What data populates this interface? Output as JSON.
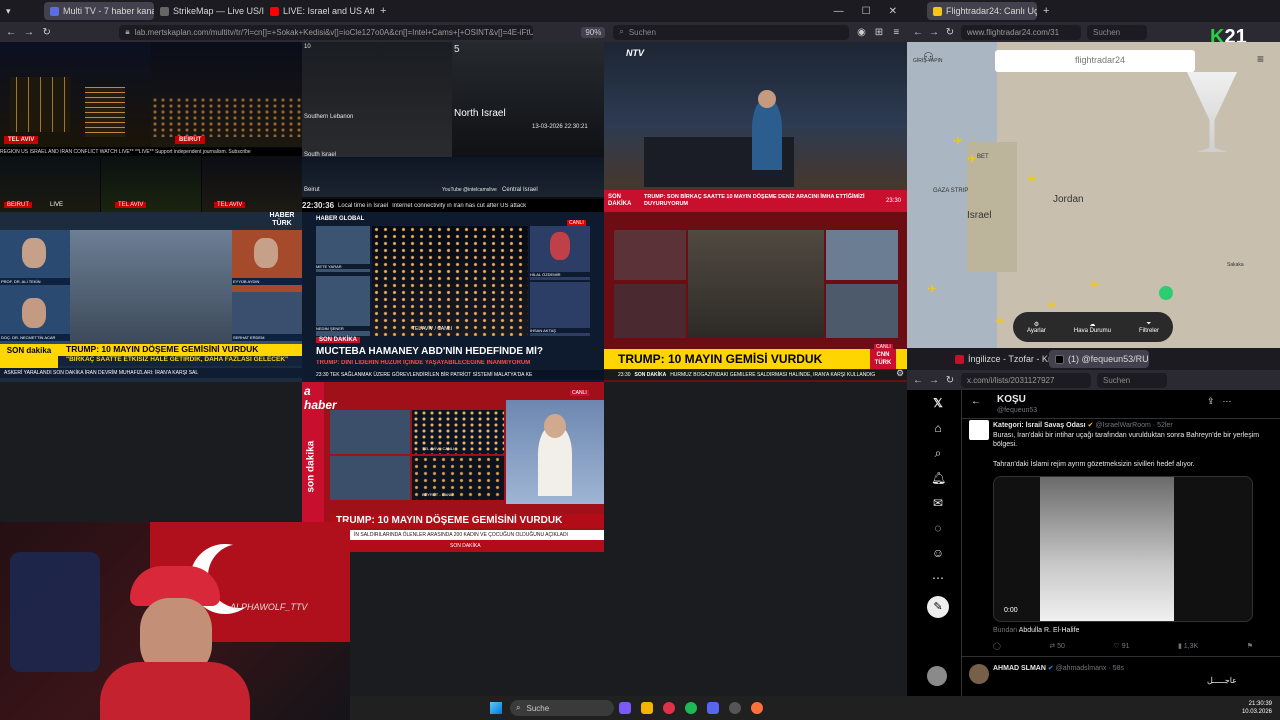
{
  "left_browser": {
    "tabs": [
      {
        "label": "Multi TV - 7 haber kanalını",
        "color": "#5b6ee1"
      },
      {
        "label": "StrikeMap — Live US/Israel Ira",
        "color": "#444"
      },
      {
        "label": "LIVE: Israel and US Attack I",
        "color": "#ff0000"
      }
    ],
    "url": "lab.mertskaplan.com/multitv/tr/?l=cn[]=+Sokak+Kedisi&v[]=ioCle127o0A&cn[]=Intel+Cams+[+OSINT&v[]=4E-iFtUM2kk",
    "zoom": "90%",
    "search_placeholder": "Suchen"
  },
  "tiles": {
    "t1": {
      "label1": "TEL AVIV",
      "label2": "BEIRUT",
      "label3": "TEL AVIV",
      "label4": "BEIRUT",
      "label5": "TEL AVIV",
      "ticker": "REGION US ISRAEL AND IRAN CONFLICT WATCH LIVE** **LIVE** Support independent journalism. Subscribe",
      "live": "LIVE"
    },
    "t2": {
      "title": "North Israel",
      "sub1": "Southern Lebanon",
      "sub2": "South Israel",
      "sub3": "Beirut",
      "sub4": "Central Israel",
      "time": "22:30:36",
      "ticker": "Local time in Israel",
      "ticker2": "Internet connectivity in Iran has cut after US attack",
      "handle": "YouTube @intelcamslive",
      "n5": "5",
      "n10": "10",
      "date1": "13-03-2026 22:30:21"
    },
    "t3": {
      "brand": "NTV",
      "headline_tag": "SON DAKİKA",
      "headline": "TRUMP: SON BİRKAÇ SAATTE 10 MAYIN DÖŞEME DENİZ ARACINI İMHA ETTİĞİMİZİ DUYURUYORUM",
      "time": "23:30"
    },
    "t4": {
      "brand": "HABER TÜRK",
      "badge": "SON dakika",
      "headline": "TRUMP: 10 MAYIN DÖŞEME GEMİSİNİ VURDUK",
      "sub": "\"BİRKAÇ SAATTE ETKİSİZ HALE GETİRDİK, DAHA FAZLASI GELECEK\"",
      "ticker": "ASKERİ YARALANDI   SON DAKİKA   İRAN DEVRİM MUHAFIZLARI: İRAN'A KARŞI SAL",
      "guest1": "PROF. DR. ALİ TEKİN",
      "guest2": "DOÇ. DR. NECMETTİN ACAR",
      "anchor": "EYYÜB AYDIN",
      "guest3": "SERHAT ERDEM"
    },
    "t5": {
      "brand": "HABER GLOBAL",
      "tag": "SON DAKİKA",
      "headline": "MÜCTEBA HAMANEY ABD'NİN HEDEFİNDE Mİ?",
      "sub": "TRUMP: DİNİ LİDERİN HUZUR İÇİNDE YAŞAYABİLECEĞİNE İNANMIYORUM",
      "ticker": "23:30  TEK SAĞLANMAK ÜZERE GÖREVLENDİRİLEN BİR PATRİOT SİSTEMİ MALATYA'DA KE",
      "loc": "TEL AVİV / CANLI",
      "g1": "METE YARAR",
      "g2": "NEDİM ŞENER",
      "g3": "İHSAN AKTAŞ",
      "g4": "HİLAL ÖZDEMİR",
      "live": "CANLI"
    },
    "t6": {
      "brand": "CNN TÜRK",
      "headline": "TRUMP: 10 MAYIN GEMİSİ VURDUK",
      "tag": "SON DAKİKA",
      "ticker": "HÜRMÜZ BOĞAZI'NDAKİ GEMİLERE SALDIRMASI HALİNDE, İRAN'A KARŞI KULLANDIĞ",
      "time": "23:30",
      "live": "CANLI"
    },
    "t7": {
      "brand": "a haber",
      "side": "son dakika",
      "headline": "TRUMP: 10 MAYIN DÖŞEME GEMİSİNİ VURDUK",
      "ticker": "İN SALDIRILARINDA ÖLENLER ARASINDA 200 KADIN VE ÇOCUĞUN OLDUĞUNU AÇIKLADI",
      "tag": "SON DAKİKA",
      "live": "CANLI",
      "loc1": "TEL AVİV - CANLI",
      "loc2": "BEYRUT - CANLI"
    }
  },
  "right_top": {
    "tab": "Flightradar24: Canlı Uçuş İzleyic",
    "url": "www.flightradar24.com/31",
    "search_placeholder": "Suchen",
    "login": "GİRİŞ YAPIN",
    "brand": "flightradar24",
    "labels": {
      "israel": "Israel",
      "jordan": "Jordan",
      "gaza": "GAZA STRIP",
      "bet": "BET",
      "saada": "Sakaka"
    },
    "bottom": [
      {
        "label": "Ayarlar"
      },
      {
        "label": "Hava Durumu"
      },
      {
        "label": "Filtreler"
      }
    ],
    "logo": "K21"
  },
  "right_bottom": {
    "tabs": [
      {
        "label": "İngilizce - Tzofar - Kırmızı Ala"
      },
      {
        "label": "(1) @fequeun53/RUN / X"
      }
    ],
    "url": "x.com/i/lists/2031127927",
    "search_placeholder": "Suchen",
    "list_title": "KOŞU",
    "list_handle": "@fequeun53",
    "post": {
      "author": "Kategori: İsrail Savaş Odası",
      "handle": "@IsraelWarRoom",
      "time": "52ler",
      "text1": "Burası, İran'daki bir intihar uçağı tarafından vurulduktan sonra Bahreyn'de bir yerleşim bölgesi.",
      "text2": "Tahran'daki İslami rejim ayrım gözetmeksizin sivilleri hedef alıyor.",
      "video_time": "0:00",
      "from_label": "Bundan",
      "from_name": "Abdulla R. El-Halife",
      "retweets": "50",
      "likes": "91",
      "views": "1,3K"
    },
    "next_post": {
      "author": "AHMAD SLMAN",
      "handle": "@ahmadslmanx",
      "time": "58s",
      "text": "عاجـــــل"
    }
  },
  "streamer": {
    "name": "ALPHAWOLF_TTV"
  },
  "taskbar": {
    "search": "Suche",
    "time": "21:30:39",
    "date": "10.03.2026"
  }
}
